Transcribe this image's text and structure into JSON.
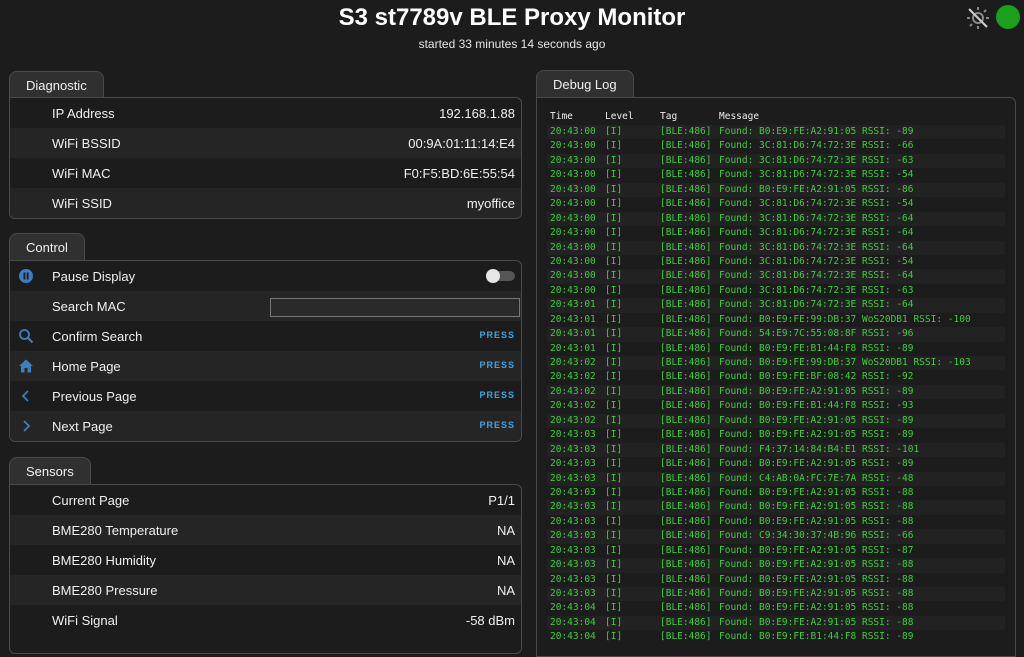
{
  "header": {
    "title": "S3 st7789v BLE Proxy Monitor",
    "subtitle": "started 33 minutes 14 seconds ago"
  },
  "diagnostic": {
    "tab": "Diagnostic",
    "rows": [
      {
        "label": "IP Address",
        "value": "192.168.1.88"
      },
      {
        "label": "WiFi BSSID",
        "value": "00:9A:01:11:14:E4"
      },
      {
        "label": "WiFi MAC",
        "value": "F0:F5:BD:6E:55:54"
      },
      {
        "label": "WiFi SSID",
        "value": "myoffice"
      }
    ]
  },
  "control": {
    "tab": "Control",
    "pause_label": "Pause Display",
    "pause_on": false,
    "search_label": "Search MAC",
    "search_value": "",
    "confirm_label": "Confirm Search",
    "home_label": "Home Page",
    "prev_label": "Previous Page",
    "next_label": "Next Page",
    "press": "PRESS"
  },
  "sensors": {
    "tab": "Sensors",
    "rows": [
      {
        "label": "Current Page",
        "value": "P1/1"
      },
      {
        "label": "BME280 Temperature",
        "value": "NA"
      },
      {
        "label": "BME280 Humidity",
        "value": "NA"
      },
      {
        "label": "BME280 Pressure",
        "value": "NA"
      },
      {
        "label": "WiFi Signal",
        "value": "-58 dBm"
      }
    ]
  },
  "log": {
    "tab": "Debug Log",
    "columns": {
      "time": "Time",
      "level": "Level",
      "tag": "Tag",
      "message": "Message"
    },
    "rows": [
      [
        "20:43:00",
        "[I]",
        "[BLE:486]",
        "Found: B0:E9:FE:A2:91:05 RSSI: -89"
      ],
      [
        "20:43:00",
        "[I]",
        "[BLE:486]",
        "Found: 3C:81:D6:74:72:3E RSSI: -66"
      ],
      [
        "20:43:00",
        "[I]",
        "[BLE:486]",
        "Found: 3C:81:D6:74:72:3E RSSI: -63"
      ],
      [
        "20:43:00",
        "[I]",
        "[BLE:486]",
        "Found: 3C:81:D6:74:72:3E RSSI: -54"
      ],
      [
        "20:43:00",
        "[I]",
        "[BLE:486]",
        "Found: B0:E9:FE:A2:91:05 RSSI: -86"
      ],
      [
        "20:43:00",
        "[I]",
        "[BLE:486]",
        "Found: 3C:81:D6:74:72:3E RSSI: -54"
      ],
      [
        "20:43:00",
        "[I]",
        "[BLE:486]",
        "Found: 3C:81:D6:74:72:3E RSSI: -64"
      ],
      [
        "20:43:00",
        "[I]",
        "[BLE:486]",
        "Found: 3C:81:D6:74:72:3E RSSI: -64"
      ],
      [
        "20:43:00",
        "[I]",
        "[BLE:486]",
        "Found: 3C:81:D6:74:72:3E RSSI: -64"
      ],
      [
        "20:43:00",
        "[I]",
        "[BLE:486]",
        "Found: 3C:81:D6:74:72:3E RSSI: -54"
      ],
      [
        "20:43:00",
        "[I]",
        "[BLE:486]",
        "Found: 3C:81:D6:74:72:3E RSSI: -64"
      ],
      [
        "20:43:00",
        "[I]",
        "[BLE:486]",
        "Found: 3C:81:D6:74:72:3E RSSI: -63"
      ],
      [
        "20:43:01",
        "[I]",
        "[BLE:486]",
        "Found: 3C:81:D6:74:72:3E RSSI: -64"
      ],
      [
        "20:43:01",
        "[I]",
        "[BLE:486]",
        "Found: B0:E9:FE:99:DB:37 WoS20DB1 RSSI: -100"
      ],
      [
        "20:43:01",
        "[I]",
        "[BLE:486]",
        "Found: 54:E9:7C:55:08:8F RSSI: -96"
      ],
      [
        "20:43:01",
        "[I]",
        "[BLE:486]",
        "Found: B0:E9:FE:B1:44:F8 RSSI: -89"
      ],
      [
        "20:43:02",
        "[I]",
        "[BLE:486]",
        "Found: B0:E9:FE:99:DB:37 WoS20DB1 RSSI: -103"
      ],
      [
        "20:43:02",
        "[I]",
        "[BLE:486]",
        "Found: B0:E9:FE:BF:08:42 RSSI: -92"
      ],
      [
        "20:43:02",
        "[I]",
        "[BLE:486]",
        "Found: B0:E9:FE:A2:91:05 RSSI: -89"
      ],
      [
        "20:43:02",
        "[I]",
        "[BLE:486]",
        "Found: B0:E9:FE:B1:44:F8 RSSI: -93"
      ],
      [
        "20:43:02",
        "[I]",
        "[BLE:486]",
        "Found: B0:E9:FE:A2:91:05 RSSI: -89"
      ],
      [
        "20:43:03",
        "[I]",
        "[BLE:486]",
        "Found: B0:E9:FE:A2:91:05 RSSI: -89"
      ],
      [
        "20:43:03",
        "[I]",
        "[BLE:486]",
        "Found: F4:37:14:84:B4:E1 RSSI: -101"
      ],
      [
        "20:43:03",
        "[I]",
        "[BLE:486]",
        "Found: B0:E9:FE:A2:91:05 RSSI: -89"
      ],
      [
        "20:43:03",
        "[I]",
        "[BLE:486]",
        "Found: C4:AB:0A:FC:7E:7A RSSI: -48"
      ],
      [
        "20:43:03",
        "[I]",
        "[BLE:486]",
        "Found: B0:E9:FE:A2:91:05 RSSI: -88"
      ],
      [
        "20:43:03",
        "[I]",
        "[BLE:486]",
        "Found: B0:E9:FE:A2:91:05 RSSI: -88"
      ],
      [
        "20:43:03",
        "[I]",
        "[BLE:486]",
        "Found: B0:E9:FE:A2:91:05 RSSI: -88"
      ],
      [
        "20:43:03",
        "[I]",
        "[BLE:486]",
        "Found: C9:34:30:37:4B:96 RSSI: -66"
      ],
      [
        "20:43:03",
        "[I]",
        "[BLE:486]",
        "Found: B0:E9:FE:A2:91:05 RSSI: -87"
      ],
      [
        "20:43:03",
        "[I]",
        "[BLE:486]",
        "Found: B0:E9:FE:A2:91:05 RSSI: -88"
      ],
      [
        "20:43:03",
        "[I]",
        "[BLE:486]",
        "Found: B0:E9:FE:A2:91:05 RSSI: -88"
      ],
      [
        "20:43:03",
        "[I]",
        "[BLE:486]",
        "Found: B0:E9:FE:A2:91:05 RSSI: -88"
      ],
      [
        "20:43:04",
        "[I]",
        "[BLE:486]",
        "Found: B0:E9:FE:A2:91:05 RSSI: -88"
      ],
      [
        "20:43:04",
        "[I]",
        "[BLE:486]",
        "Found: B0:E9:FE:A2:91:05 RSSI: -88"
      ],
      [
        "20:43:04",
        "[I]",
        "[BLE:486]",
        "Found: B0:E9:FE:B1:44:F8 RSSI: -89"
      ]
    ]
  },
  "colors": {
    "background": "#1c1c1c",
    "accent": "#3ea6e0",
    "log_text": "#3ecf3e",
    "status_online": "#1aa01a"
  },
  "icons": [
    "theme-toggle-icon",
    "pause-icon",
    "search-icon",
    "home-icon",
    "chevron-left-icon",
    "chevron-right-icon"
  ]
}
